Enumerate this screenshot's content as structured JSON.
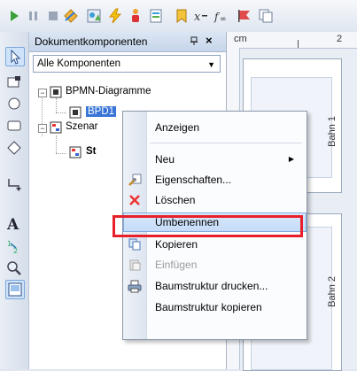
{
  "toolbar": {
    "icons": [
      "play-icon",
      "pause-icon",
      "stop-icon",
      "diamond-arrow-icon",
      "shapes-icon",
      "lightning-icon",
      "person-icon",
      "document-icon",
      "bookmark-icon",
      "formula-x-icon",
      "function-icon",
      "flag-icon",
      "copy-icon"
    ]
  },
  "toolstrip": {
    "icons": [
      "pointer-icon",
      "circle-icon",
      "rectangle-icon",
      "diamond-icon",
      "connector-icon",
      "text-icon",
      "numbering-icon",
      "zoom-icon",
      "page-icon"
    ]
  },
  "pane": {
    "title": "Dokumentkomponenten",
    "close_glyph": "×",
    "filter": {
      "value": "Alle Komponenten"
    }
  },
  "tree": {
    "root": "BPMN-Diagramme",
    "child_selected": "BPD1",
    "root2": "Szenar",
    "child2": "St"
  },
  "canvas": {
    "ruler_unit": "cm",
    "ruler_mark": "2",
    "lane1_label": "Bahn 1",
    "lane2_label": "Bahn 2"
  },
  "context_menu": {
    "items": [
      {
        "label": "Anzeigen",
        "icon": "none",
        "disabled": false
      },
      {
        "label": "Neu",
        "icon": "none",
        "disabled": false,
        "submenu": true
      },
      {
        "label": "Eigenschaften...",
        "icon": "properties-icon",
        "disabled": false
      },
      {
        "label": "Löschen",
        "icon": "delete-icon",
        "disabled": false
      },
      {
        "label": "Umbenennen",
        "icon": "none",
        "disabled": false,
        "highlighted": true
      },
      {
        "label": "Kopieren",
        "icon": "copy-icon",
        "disabled": false
      },
      {
        "label": "Einfügen",
        "icon": "paste-icon",
        "disabled": true
      },
      {
        "label": "Baumstruktur drucken...",
        "icon": "print-icon",
        "disabled": false
      },
      {
        "label": "Baumstruktur kopieren",
        "icon": "none",
        "disabled": false
      }
    ]
  },
  "colors": {
    "highlight_box": "#e8202a",
    "selection": "#3875d7"
  }
}
